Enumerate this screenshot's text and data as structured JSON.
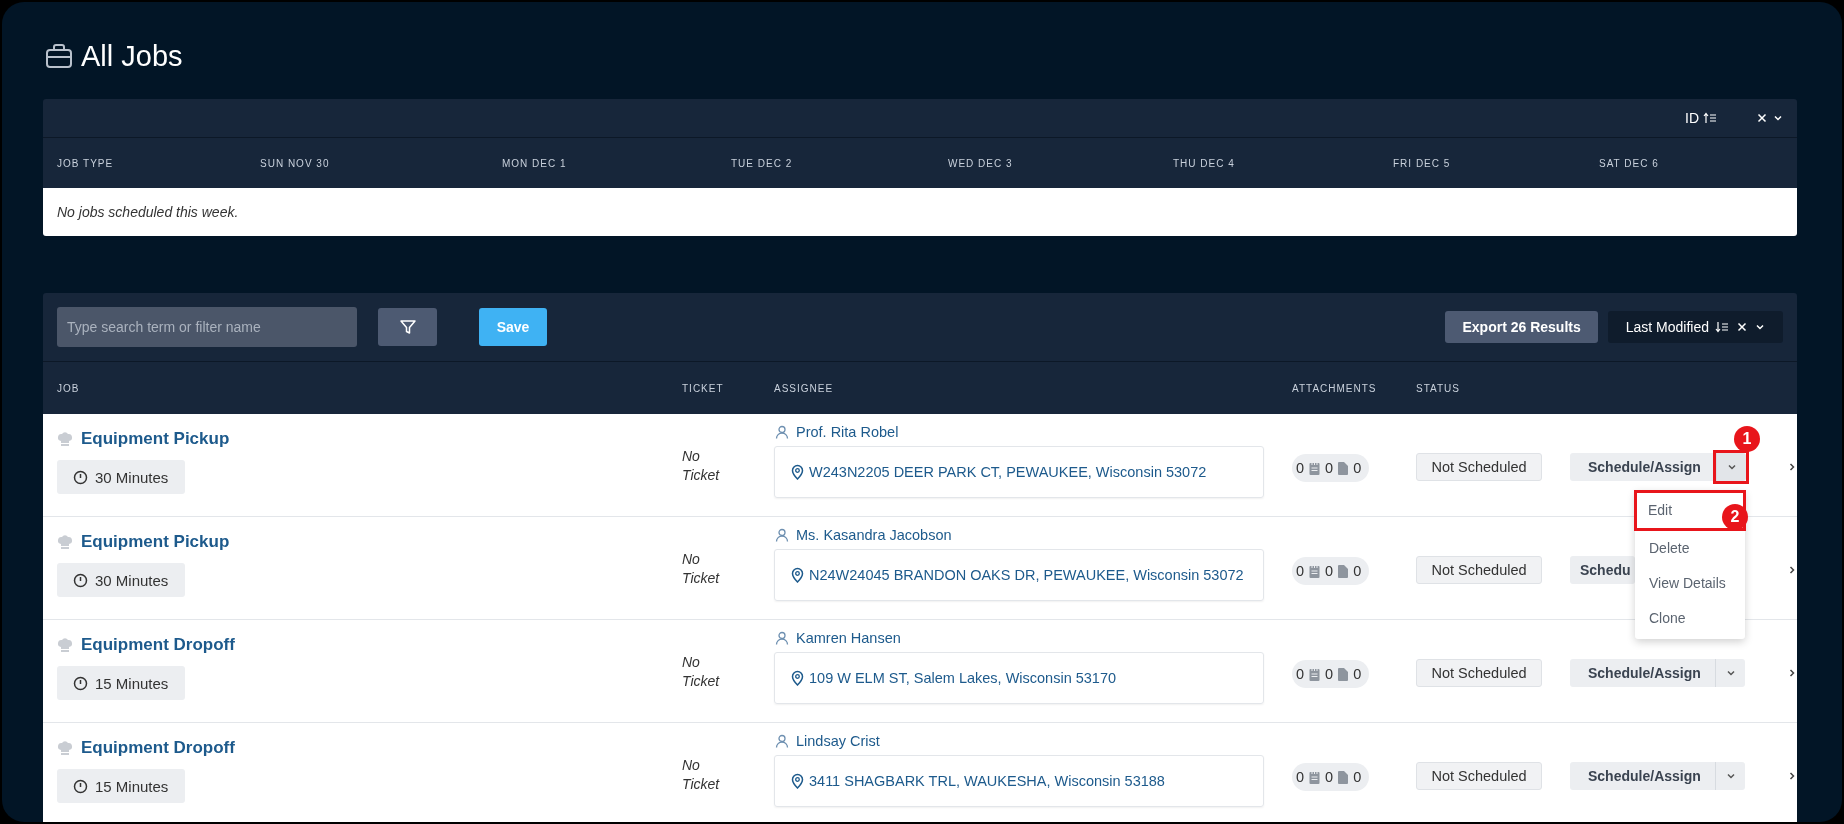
{
  "page": {
    "title": "All Jobs"
  },
  "calendar": {
    "sort": {
      "label": "ID"
    },
    "columns": [
      "JOB TYPE",
      "SUN NOV 30",
      "MON DEC 1",
      "TUE DEC 2",
      "WED DEC 3",
      "THU DEC 4",
      "FRI DEC 5",
      "SAT DEC 6"
    ],
    "empty_message": "No jobs scheduled this week."
  },
  "toolbar": {
    "search": {
      "placeholder": "Type search term or filter name"
    },
    "save_button": "Save",
    "export_button": "Export 26 Results",
    "sort": {
      "label": "Last Modified"
    }
  },
  "table": {
    "columns": [
      "JOB",
      "TICKET",
      "ASSIGNEE",
      "ATTACHMENTS",
      "STATUS"
    ],
    "rows": [
      {
        "job_type": "Equipment Pickup",
        "duration": "30 Minutes",
        "ticket": "No Ticket",
        "assignee": "Prof. Rita Robel",
        "address": "W243N2205 DEER PARK CT, PEWAUKEE, Wisconsin 53072",
        "attachments": {
          "count": "0",
          "notes": "0",
          "files": "0"
        },
        "status": "Not Scheduled",
        "action": "Schedule/Assign",
        "split_caret": true,
        "menu_open": true
      },
      {
        "job_type": "Equipment Pickup",
        "duration": "30 Minutes",
        "ticket": "No Ticket",
        "assignee": "Ms. Kasandra Jacobson",
        "address": "N24W24045 BRANDON OAKS DR, PEWAUKEE, Wisconsin 53072",
        "attachments": {
          "count": "0",
          "notes": "0",
          "files": "0"
        },
        "status": "Not Scheduled",
        "action": "Schedu",
        "split_caret": false,
        "menu_open": false
      },
      {
        "job_type": "Equipment Dropoff",
        "duration": "15 Minutes",
        "ticket": "No Ticket",
        "assignee": "Kamren Hansen",
        "address": "109 W ELM ST, Salem Lakes, Wisconsin 53170",
        "attachments": {
          "count": "0",
          "notes": "0",
          "files": "0"
        },
        "status": "Not Scheduled",
        "action": "Schedule/Assign",
        "split_caret": true,
        "menu_open": false
      },
      {
        "job_type": "Equipment Dropoff",
        "duration": "15 Minutes",
        "ticket": "No Ticket",
        "assignee": "Lindsay Crist",
        "address": "3411 SHAGBARK TRL, WAUKESHA, Wisconsin 53188",
        "attachments": {
          "count": "0",
          "notes": "0",
          "files": "0"
        },
        "status": "Not Scheduled",
        "action": "Schedule/Assign",
        "split_caret": true,
        "menu_open": false
      }
    ]
  },
  "row_menu": {
    "items": [
      "Edit",
      "Delete",
      "View Details",
      "Clone"
    ]
  },
  "annotations": [
    {
      "label": "1"
    },
    {
      "label": "2"
    }
  ]
}
